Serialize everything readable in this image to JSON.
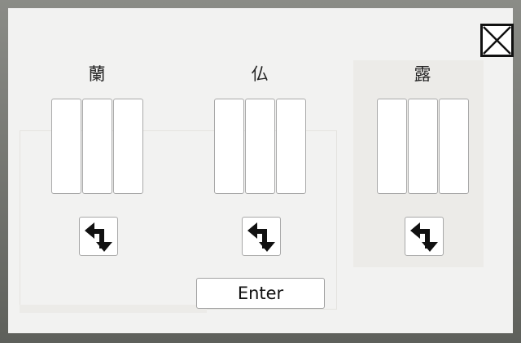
{
  "dialog": {
    "close_icon": "close-box-icon",
    "columns": [
      {
        "character": "蘭",
        "slot_count": 3,
        "swap_icon": "swap-arrows-icon"
      },
      {
        "character": "仏",
        "slot_count": 3,
        "swap_icon": "swap-arrows-icon"
      },
      {
        "character": "露",
        "slot_count": 3,
        "swap_icon": "swap-arrows-icon"
      }
    ],
    "enter_label": "Enter"
  },
  "colors": {
    "dialog_bg": "#f2f2f1",
    "slot_bg": "#ffffff",
    "slot_border": "#a9a9a9",
    "icon": "#111111"
  }
}
